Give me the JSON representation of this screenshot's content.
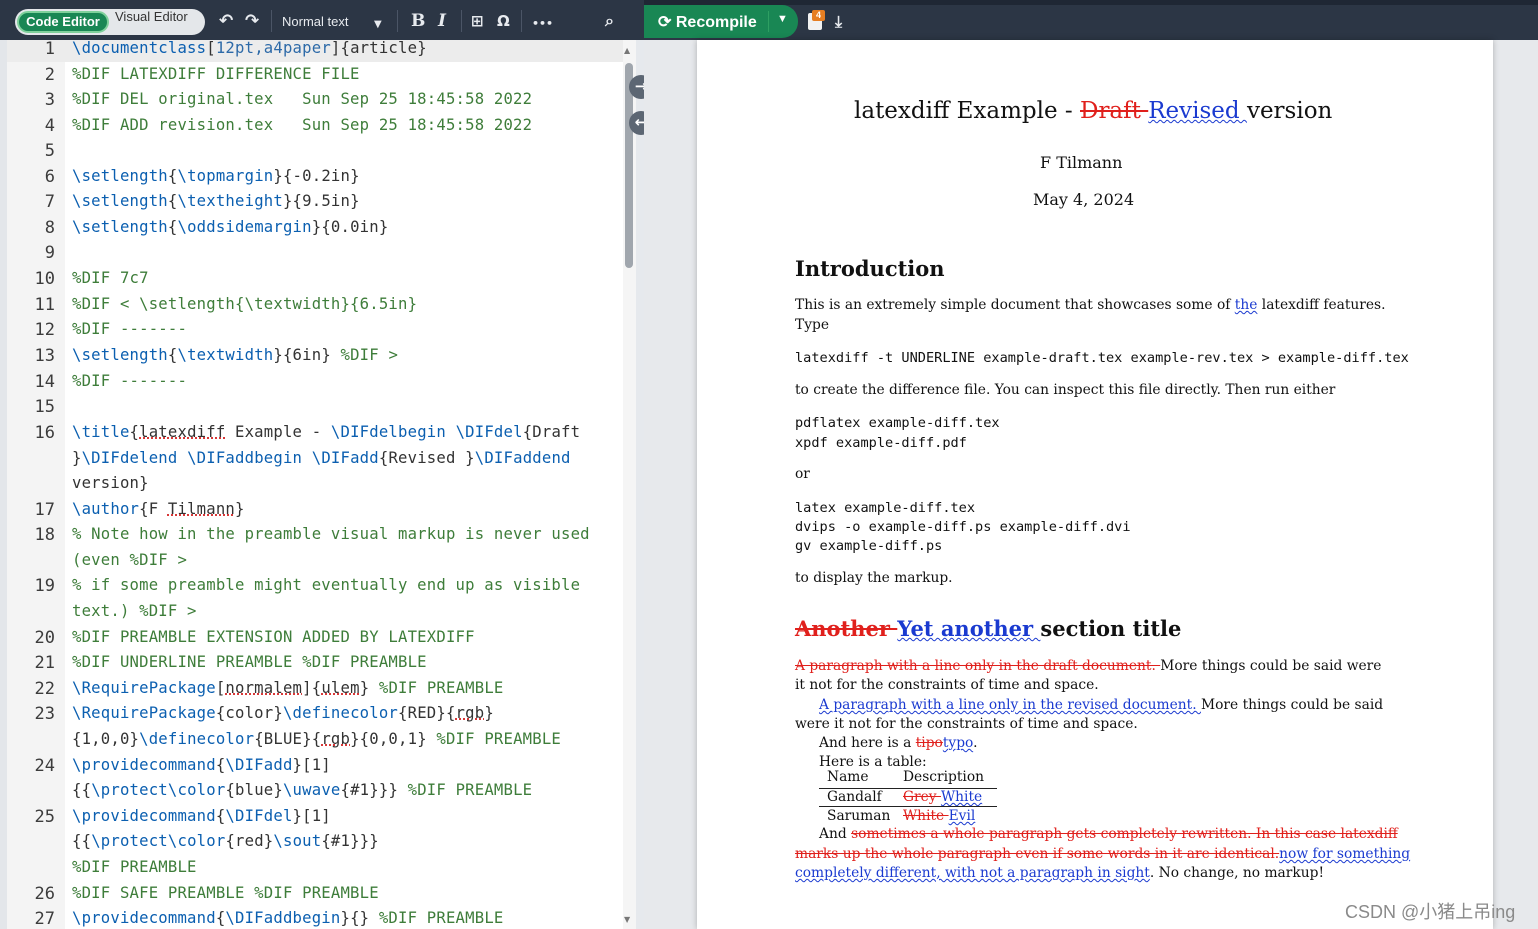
{
  "toolbar": {
    "code_editor": "Code Editor",
    "visual_editor": "Visual Editor",
    "undo_icon": "↶",
    "redo_icon": "↷",
    "text_style": "Normal text",
    "bold": "B",
    "italic": "I",
    "more": "•••",
    "recompile": "Recompile",
    "badge": "4"
  },
  "editor": {
    "line_numbers": [
      "1",
      "2",
      "3",
      "4",
      "5",
      "6",
      "7",
      "8",
      "9",
      "10",
      "11",
      "12",
      "13",
      "14",
      "15",
      "16",
      "17",
      "18",
      "19",
      "20",
      "21",
      "22",
      "23",
      "24",
      "25",
      "26",
      "27"
    ]
  },
  "preview": {
    "title_a": "latexdiff Example - ",
    "title_del": "Draft ",
    "title_add": "Revised ",
    "title_b": "version",
    "author": "F Tilmann",
    "date": "May 4, 2024",
    "h_intro": "Introduction",
    "intro_a": "This is an extremely simple document that showcases some of ",
    "intro_add": "the",
    "intro_b": " latexdiff features.",
    "intro_c": "Type",
    "cmd1": "latexdiff -t UNDERLINE example-draft.tex example-rev.tex > example-diff.tex",
    "p_create": "to create the difference file.  You can inspect this file directly.  Then run either",
    "cmd2": "pdflatex example-diff.tex",
    "cmd3": "xpdf example-diff.pdf",
    "or": "or",
    "cmd4": "latex example-diff.tex",
    "cmd5": "dvips -o example-diff.ps example-diff.dvi",
    "cmd6": "gv example-diff.ps",
    "p_display": "to display the markup.",
    "h2_del": "Another ",
    "h2_add": "Yet another ",
    "h2_b": "section title",
    "l1_del": "A paragraph with a line only in the draft document. ",
    "l1_b": "More things could be said were",
    "l2": "it not for the constraints of time and space.",
    "l3_add": "A paragraph with a line only in the revised document. ",
    "l3_b": "More things could be said",
    "l4": "were it not for the constraints of time and space.",
    "l5_a": "And here is a ",
    "l5_del": "tipo",
    "l5_add": "typo",
    "l5_b": ".",
    "l6": "Here is a table:",
    "th_name": "Name",
    "th_desc": "Description",
    "r1_name": "Gandalf",
    "r1_del": "Grey ",
    "r1_add": "White",
    "r2_name": "Saruman",
    "r2_del": "White ",
    "r2_add": "Evil",
    "l7_a": "And ",
    "l7_del": "sometimes a whole paragraph gets completely rewritten. In this case latexdiff",
    "l8_del": "marks up the whole paragraph even if some words in it are identical.",
    "l8_add": "now for something",
    "l9_add": "completely different, with not a paragraph in sight",
    "l9_b": ". No change, no markup!"
  },
  "watermark": "CSDN @小猪上吊ing"
}
